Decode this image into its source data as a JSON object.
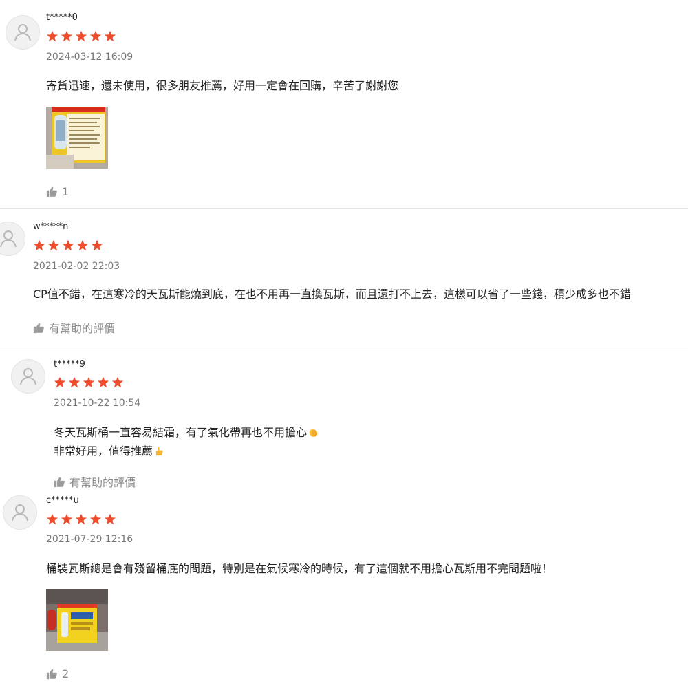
{
  "reviews": [
    {
      "username": "t*****0",
      "rating": 5,
      "date": "2024-03-12 16:09",
      "comment": [
        "寄貨迅速，還未使用，很多朋友推薦，好用一定會在回購，辛苦了謝謝您"
      ],
      "has_photo": true,
      "like_text": "1"
    },
    {
      "username": "w*****n",
      "rating": 5,
      "date": "2021-02-02 22:03",
      "comment": [
        "CP值不錯，在這寒冷的天瓦斯能燒到底，在也不用再一直換瓦斯，而且還打不上去，這樣可以省了一些錢，積少成多也不錯"
      ],
      "has_photo": false,
      "like_text": "有幫助的評價"
    },
    {
      "username": "t*****9",
      "rating": 5,
      "date": "2021-10-22 10:54",
      "comment": [
        "冬天瓦斯桶一直容易結霜，有了氣化帶再也不用擔心",
        "非常好用，值得推薦"
      ],
      "has_photo": false,
      "like_text": "有幫助的評價"
    },
    {
      "username": "c*****u",
      "rating": 5,
      "date": "2021-07-29 12:16",
      "comment": [
        "桶裝瓦斯總是會有殘留桶底的問題，特別是在氣候寒冷的時候，有了這個就不用擔心瓦斯用不完問題啦！"
      ],
      "has_photo": true,
      "like_text": "2"
    }
  ],
  "colors": {
    "star": "#ee4d2d",
    "muted": "#777777",
    "divider": "#e6e6e6"
  },
  "icons": {
    "avatar": "user-avatar-icon",
    "star": "star-icon",
    "like": "thumbs-up-icon",
    "emoji_1": "clapping-hands-emoji",
    "emoji_2": "thumbs-up-emoji"
  }
}
